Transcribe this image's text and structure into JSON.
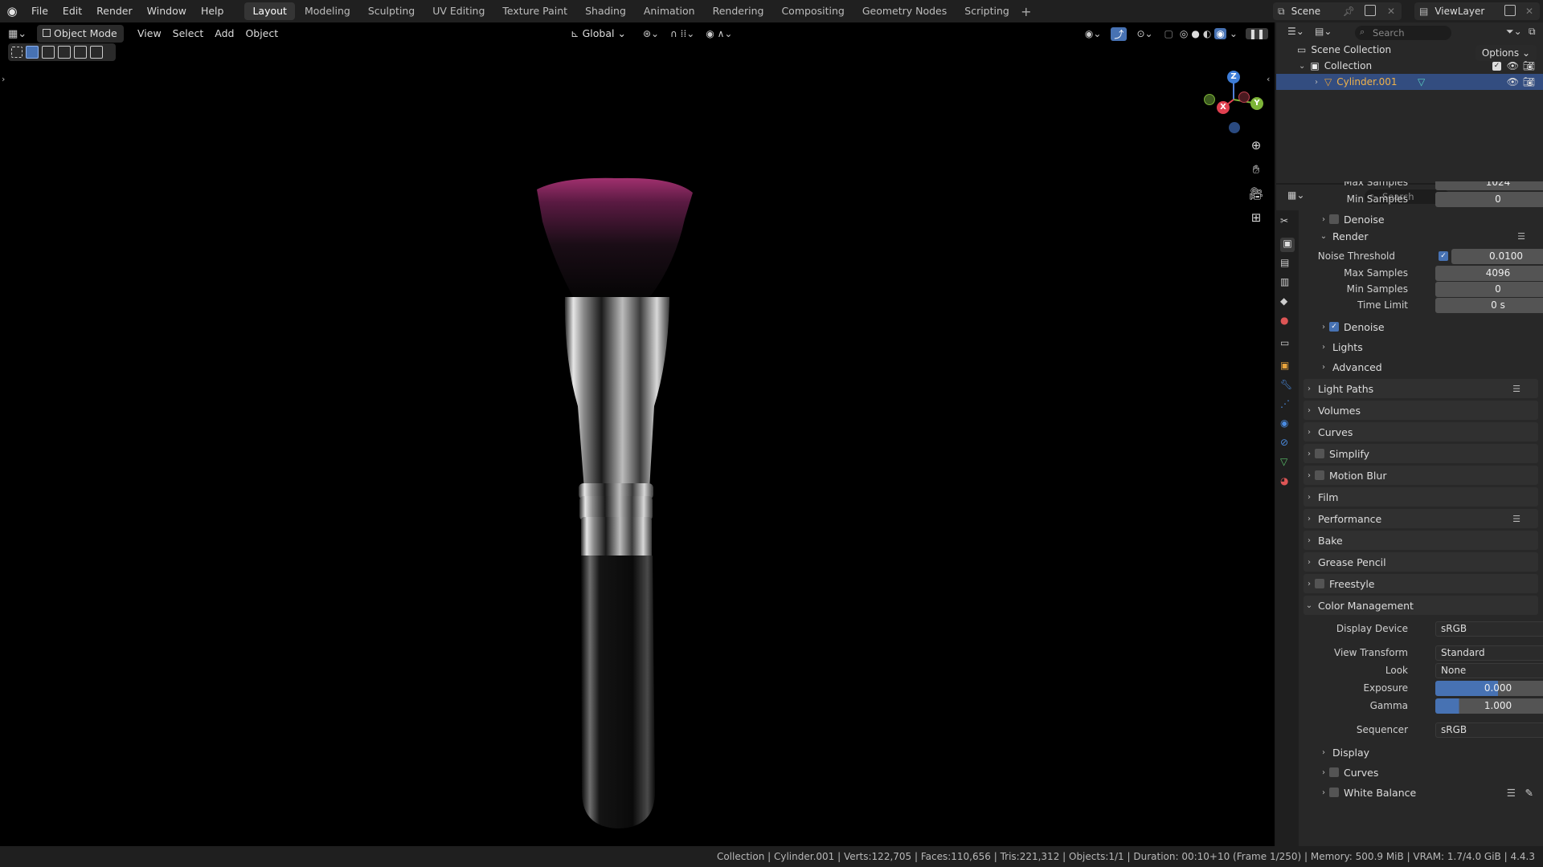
{
  "menu": {
    "file": "File",
    "edit": "Edit",
    "render": "Render",
    "window": "Window",
    "help": "Help"
  },
  "workspaces": [
    "Layout",
    "Modeling",
    "Sculpting",
    "UV Editing",
    "Texture Paint",
    "Shading",
    "Animation",
    "Rendering",
    "Compositing",
    "Geometry Nodes",
    "Scripting"
  ],
  "active_workspace": "Layout",
  "scene": {
    "name": "Scene",
    "view_layer": "ViewLayer"
  },
  "viewport_header": {
    "mode": "Object Mode",
    "view": "View",
    "select": "Select",
    "add": "Add",
    "object": "Object",
    "transform": "Global",
    "options": "Options"
  },
  "outliner": {
    "search_placeholder": "Search",
    "scene_collection": "Scene Collection",
    "collection": "Collection",
    "object": "Cylinder.001"
  },
  "properties": {
    "search_placeholder": "Search",
    "top_partial": {
      "max_samples_label": "Max Samples",
      "max_samples_value": "1024",
      "min_samples_label": "Min Samples",
      "min_samples_value": "0"
    },
    "denoise_viewport": "Denoise",
    "render_panel": "Render",
    "noise_threshold_label": "Noise Threshold",
    "noise_threshold": "0.0100",
    "max_samples_label": "Max Samples",
    "max_samples": "4096",
    "min_samples_label": "Min Samples",
    "min_samples": "0",
    "time_limit_label": "Time Limit",
    "time_limit": "0 s",
    "denoise_render": "Denoise",
    "lights": "Lights",
    "advanced": "Advanced",
    "panels": [
      "Light Paths",
      "Volumes",
      "Curves",
      "Simplify",
      "Motion Blur",
      "Film",
      "Performance",
      "Bake",
      "Grease Pencil",
      "Freestyle"
    ],
    "color_management": "Color Management",
    "display_device_label": "Display Device",
    "display_device": "sRGB",
    "view_transform_label": "View Transform",
    "view_transform": "Standard",
    "look_label": "Look",
    "look": "None",
    "exposure_label": "Exposure",
    "exposure": "0.000",
    "gamma_label": "Gamma",
    "gamma": "1.000",
    "sequencer_label": "Sequencer",
    "sequencer": "sRGB",
    "display": "Display",
    "curves_sub": "Curves",
    "white_balance": "White Balance"
  },
  "gizmo": {
    "z": "Z",
    "y": "Y",
    "x": "X"
  },
  "status": "Collection | Cylinder.001 | Verts:122,705 | Faces:110,656 | Tris:221,312 | Objects:1/1 | Duration: 00:10+10 (Frame 1/250) | Memory: 500.9 MiB | VRAM: 1.7/4.0 GiB | 4.4.3",
  "colors": {
    "accent": "#4772b3",
    "selected_row": "#334d80",
    "object_orange": "#e8a33c",
    "bristle_tip": "#a0306e"
  }
}
